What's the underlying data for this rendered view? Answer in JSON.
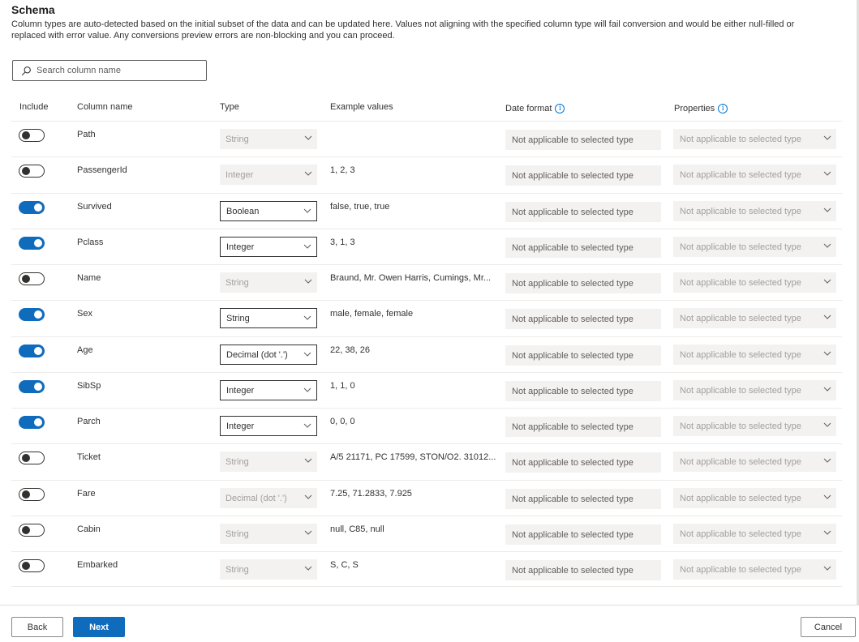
{
  "title": "Schema",
  "description": "Column types are auto-detected based on the initial subset of the data and can be updated here. Values not aligning with the specified column type will fail conversion and would be either null-filled or replaced with error value. Any conversions preview errors are non-blocking and you can proceed.",
  "search": {
    "placeholder": "Search column name",
    "value": ""
  },
  "headers": {
    "include": "Include",
    "column_name": "Column name",
    "type": "Type",
    "example_values": "Example values",
    "date_format": "Date format",
    "properties": "Properties"
  },
  "colors": {
    "accent": "#0f6cbd",
    "disabled_bg": "#f3f2f1",
    "border": "#edebe9"
  },
  "rows": [
    {
      "included": false,
      "name": "Path",
      "type": "String",
      "example": "",
      "date_format": "Not applicable to selected type",
      "properties": "Not applicable to selected type"
    },
    {
      "included": false,
      "name": "PassengerId",
      "type": "Integer",
      "example": "1, 2, 3",
      "date_format": "Not applicable to selected type",
      "properties": "Not applicable to selected type"
    },
    {
      "included": true,
      "name": "Survived",
      "type": "Boolean",
      "example": "false, true, true",
      "date_format": "Not applicable to selected type",
      "properties": "Not applicable to selected type"
    },
    {
      "included": true,
      "name": "Pclass",
      "type": "Integer",
      "example": "3, 1, 3",
      "date_format": "Not applicable to selected type",
      "properties": "Not applicable to selected type"
    },
    {
      "included": false,
      "name": "Name",
      "type": "String",
      "example": "Braund, Mr. Owen Harris, Cumings, Mr...",
      "date_format": "Not applicable to selected type",
      "properties": "Not applicable to selected type"
    },
    {
      "included": true,
      "name": "Sex",
      "type": "String",
      "example": "male, female, female",
      "date_format": "Not applicable to selected type",
      "properties": "Not applicable to selected type"
    },
    {
      "included": true,
      "name": "Age",
      "type": "Decimal (dot '.')",
      "example": "22, 38, 26",
      "date_format": "Not applicable to selected type",
      "properties": "Not applicable to selected type"
    },
    {
      "included": true,
      "name": "SibSp",
      "type": "Integer",
      "example": "1, 1, 0",
      "date_format": "Not applicable to selected type",
      "properties": "Not applicable to selected type"
    },
    {
      "included": true,
      "name": "Parch",
      "type": "Integer",
      "example": "0, 0, 0",
      "date_format": "Not applicable to selected type",
      "properties": "Not applicable to selected type"
    },
    {
      "included": false,
      "name": "Ticket",
      "type": "String",
      "example": "A/5 21171, PC 17599, STON/O2. 31012...",
      "date_format": "Not applicable to selected type",
      "properties": "Not applicable to selected type"
    },
    {
      "included": false,
      "name": "Fare",
      "type": "Decimal (dot '.')",
      "example": "7.25, 71.2833, 7.925",
      "date_format": "Not applicable to selected type",
      "properties": "Not applicable to selected type"
    },
    {
      "included": false,
      "name": "Cabin",
      "type": "String",
      "example": "null, C85, null",
      "date_format": "Not applicable to selected type",
      "properties": "Not applicable to selected type"
    },
    {
      "included": false,
      "name": "Embarked",
      "type": "String",
      "example": "S, C, S",
      "date_format": "Not applicable to selected type",
      "properties": "Not applicable to selected type"
    }
  ],
  "footer": {
    "back": "Back",
    "next": "Next",
    "cancel": "Cancel"
  }
}
